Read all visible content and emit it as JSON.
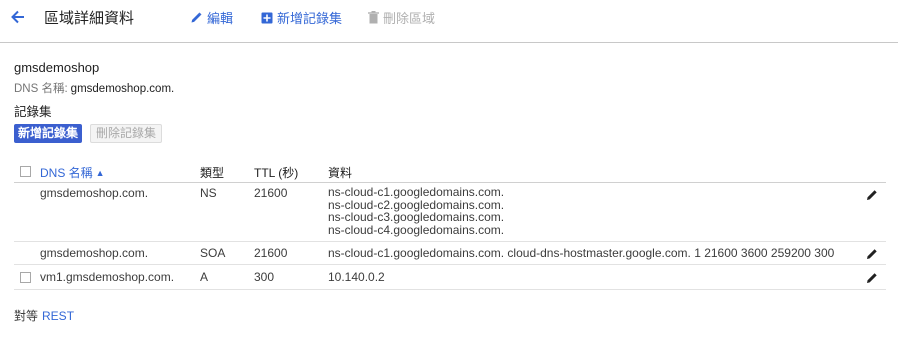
{
  "header": {
    "title": "區域詳細資料",
    "actions": {
      "edit": "編輯",
      "add_record_set": "新增記錄集",
      "delete_zone": "刪除區域"
    }
  },
  "zone": {
    "name": "gmsdemoshop",
    "dns_label": "DNS 名稱:",
    "dns_value": "gmsdemoshop.com."
  },
  "records_section": {
    "title": "記錄集",
    "add_button": "新增記錄集",
    "delete_button": "刪除記錄集"
  },
  "table": {
    "columns": {
      "dns_name": "DNS 名稱",
      "type": "類型",
      "ttl": "TTL (秒)",
      "data": "資料"
    },
    "rows": [
      {
        "dns_name": "gmsdemoshop.com.",
        "type": "NS",
        "ttl": "21600",
        "data": [
          "ns-cloud-c1.googledomains.com.",
          "ns-cloud-c2.googledomains.com.",
          "ns-cloud-c3.googledomains.com.",
          "ns-cloud-c4.googledomains.com."
        ]
      },
      {
        "dns_name": "gmsdemoshop.com.",
        "type": "SOA",
        "ttl": "21600",
        "data": [
          "ns-cloud-c1.googledomains.com. cloud-dns-hostmaster.google.com. 1 21600 3600 259200 300"
        ]
      },
      {
        "dns_name": "vm1.gmsdemoshop.com.",
        "type": "A",
        "ttl": "300",
        "data": [
          "10.140.0.2"
        ]
      }
    ]
  },
  "footer": {
    "prefix": "對等",
    "link": "REST"
  },
  "colors": {
    "accent": "#3367d6",
    "primary_button": "#3b5fcf",
    "disabled_text": "#b0b0b0"
  },
  "icons": [
    "back-arrow-icon",
    "pencil-icon",
    "plus-box-icon",
    "trash-icon"
  ]
}
